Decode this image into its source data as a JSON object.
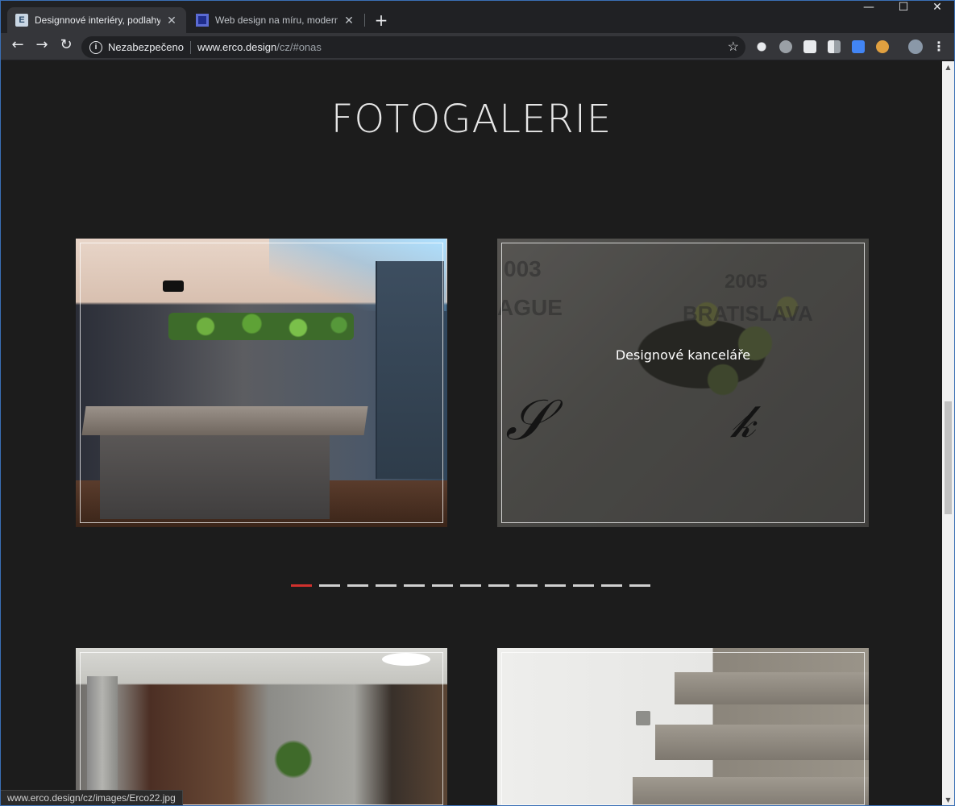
{
  "browser": {
    "tabs": [
      {
        "title": "Designnové interiéry, podlahy, st",
        "favicon": "erco-logo-icon",
        "active": true
      },
      {
        "title": "Web design na míru, moderní, re",
        "favicon": "webdesign-logo-icon",
        "active": false
      }
    ],
    "new_tab_label": "+",
    "window_controls": {
      "minimize": "—",
      "maximize": "☐",
      "close": "✕"
    },
    "nav": {
      "back": "←",
      "forward": "→",
      "reload": "↻"
    },
    "address": {
      "security_label": "Nezabezpečeno",
      "host": "www.erco.design",
      "path": "/cz/#onas"
    },
    "bookmark_icon": "star-icon",
    "extensions": [
      "lightbulb-icon",
      "skype-icon",
      "checkmark-icon",
      "reader-icon",
      "translate-icon",
      "face-icon"
    ],
    "accent": "#3a6fb5"
  },
  "page": {
    "heading": "FOTOGALERIE",
    "gallery": [
      {
        "name": "kitchen-photo",
        "caption": ""
      },
      {
        "name": "office-wall-photo",
        "caption": "Designové kanceláře"
      },
      {
        "name": "lobby-photo",
        "caption": ""
      },
      {
        "name": "stairs-photo",
        "caption": ""
      }
    ],
    "wall_texts": {
      "year_left": "003",
      "city_left": "AGUE",
      "year_right": "2005",
      "city_right": "BRATISLAVA"
    },
    "pagination": {
      "total": 13,
      "active_index": 0,
      "active_color": "#d0312d",
      "inactive_color": "#d0d0d0"
    }
  },
  "status_bar": {
    "url": "www.erco.design/cz/images/Erco22.jpg"
  }
}
